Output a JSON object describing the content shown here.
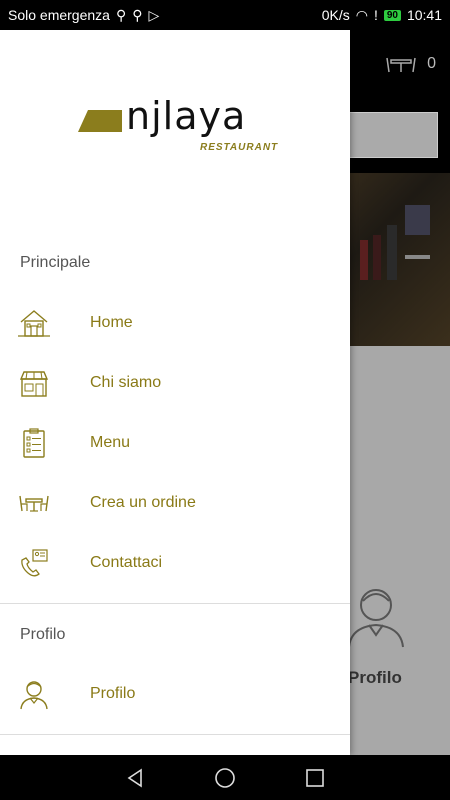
{
  "status_bar": {
    "carrier": "Solo emergenza",
    "speed": "0K/s",
    "battery": "90",
    "time": "10:41"
  },
  "background": {
    "cart_count": "0",
    "profile_tile_label": "Profilo"
  },
  "drawer": {
    "logo_word": "njlaya",
    "logo_sub": "RESTAURANT",
    "section_main": "Principale",
    "main_items": [
      {
        "label": "Home",
        "icon": "house-icon"
      },
      {
        "label": "Chi siamo",
        "icon": "storefront-icon"
      },
      {
        "label": "Menu",
        "icon": "clipboard-list-icon"
      },
      {
        "label": "Crea un ordine",
        "icon": "dining-table-icon"
      },
      {
        "label": "Contattaci",
        "icon": "phone-contact-icon"
      }
    ],
    "section_profile": "Profilo",
    "profile_items": [
      {
        "label": "Profilo",
        "icon": "user-avatar-icon"
      }
    ]
  },
  "colors": {
    "accent": "#8a7a17",
    "icon_stroke": "#8b7d1d"
  }
}
